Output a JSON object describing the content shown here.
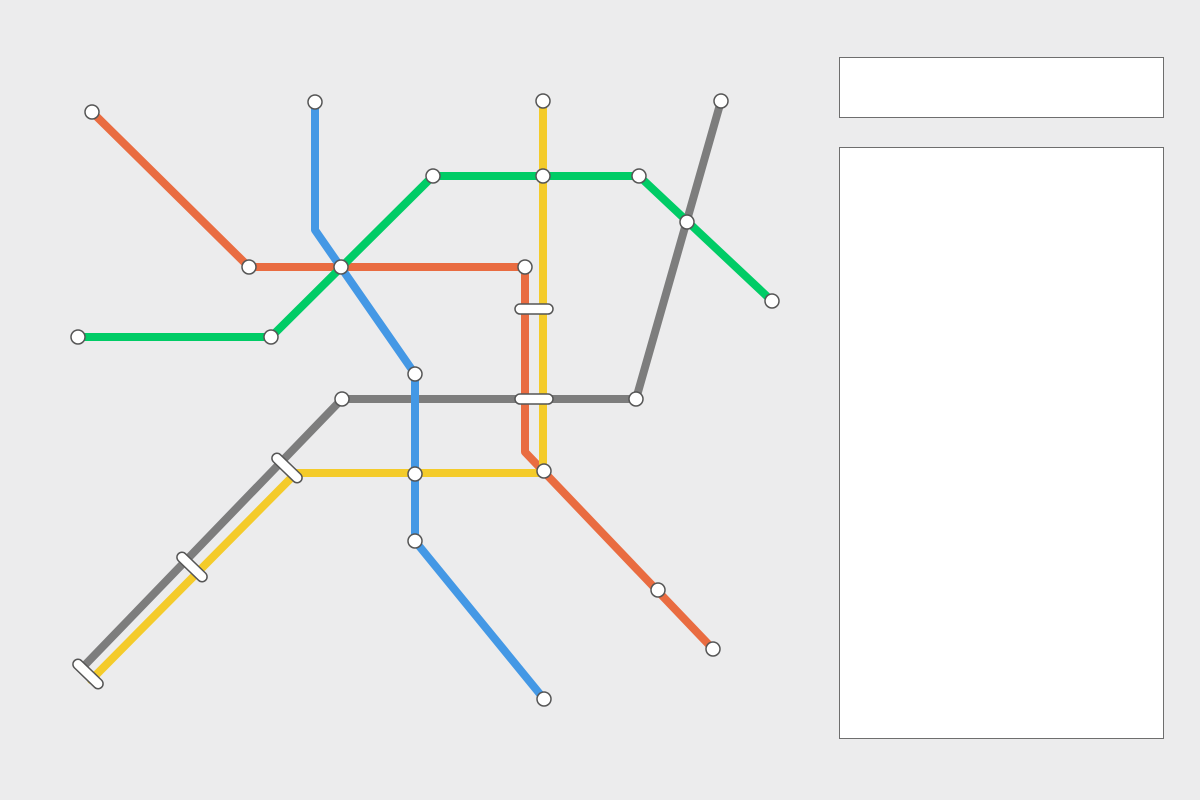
{
  "map": {
    "lines": [
      {
        "id": "red",
        "color": "#e96c41"
      },
      {
        "id": "blue",
        "color": "#4498e5"
      },
      {
        "id": "green",
        "color": "#00cc66"
      },
      {
        "id": "yellow",
        "color": "#f4cb2a"
      },
      {
        "id": "gray",
        "color": "#7d7d7d"
      }
    ],
    "station_style": {
      "fill": "#ffffff",
      "stroke": "#555555"
    }
  },
  "search_box": {
    "value": ""
  },
  "details_panel": {
    "content": ""
  }
}
